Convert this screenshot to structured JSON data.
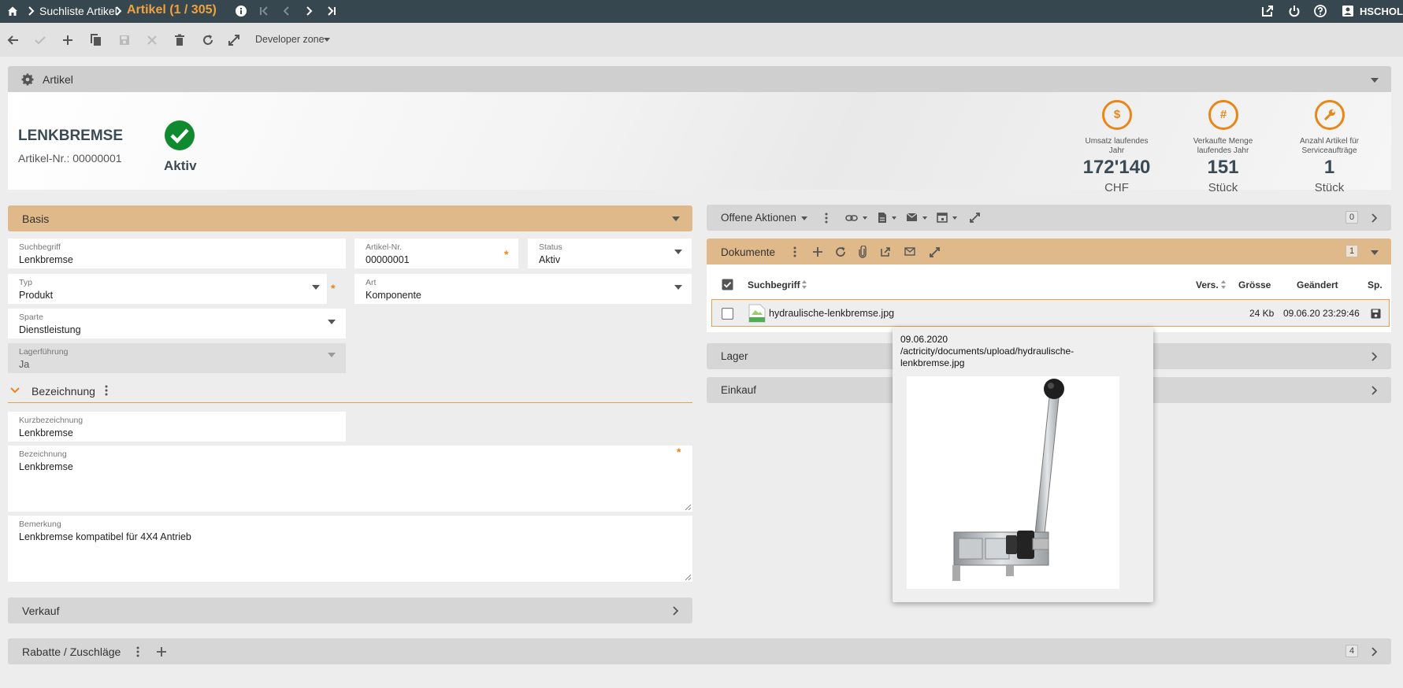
{
  "topbar": {
    "breadcrumb": "Suchliste Artikel",
    "title": "Artikel (1 / 305)",
    "user": "HSCHOL"
  },
  "toolbar": {
    "developer": "Developer zone"
  },
  "artikel_panel": {
    "title": "Artikel"
  },
  "header": {
    "name": "LENKBREMSE",
    "number": "Artikel-Nr.: 00000001",
    "status": "Aktiv"
  },
  "kpis": [
    {
      "caption1": "Umsatz laufendes",
      "caption2": "Jahr",
      "value": "172'140",
      "unit": "CHF",
      "icon": "dollar-icon"
    },
    {
      "caption1": "Verkaufte Menge",
      "caption2": "laufendes Jahr",
      "value": "151",
      "unit": "Stück",
      "icon": "hash-icon"
    },
    {
      "caption1": "Anzahl Artikel für",
      "caption2": "Serviceaufträge",
      "value": "1",
      "unit": "Stück",
      "icon": "wrench-icon"
    }
  ],
  "basis": {
    "title": "Basis",
    "suchbegriff": {
      "label": "Suchbegriff",
      "value": "Lenkbremse"
    },
    "artikelnr": {
      "label": "Artikel-Nr.",
      "value": "00000001"
    },
    "status": {
      "label": "Status",
      "value": "Aktiv"
    },
    "typ": {
      "label": "Typ",
      "value": "Produkt"
    },
    "art": {
      "label": "Art",
      "value": "Komponente"
    },
    "sparte": {
      "label": "Sparte",
      "value": "Dienstleistung"
    },
    "lager": {
      "label": "Lagerführung",
      "value": "Ja"
    },
    "req_mark": "*"
  },
  "bezeichnung": {
    "title": "Bezeichnung",
    "kurz": {
      "label": "Kurzbezeichnung",
      "value": "Lenkbremse"
    },
    "bez": {
      "label": "Bezeichnung",
      "value": "Lenkbremse"
    },
    "bemerkung": {
      "label": "Bemerkung",
      "value": "Lenkbremse kompatibel für 4X4 Antrieb"
    }
  },
  "verkauf": {
    "title": "Verkauf"
  },
  "rabatte": {
    "title": "Rabatte / Zuschläge",
    "count": "4"
  },
  "aktionen": {
    "title": "Offene Aktionen",
    "count": "0"
  },
  "dokumente": {
    "title": "Dokumente",
    "count": "1",
    "columns": {
      "suchbegriff": "Suchbegriff",
      "vers": "Vers.",
      "groesse": "Grösse",
      "geaendert": "Geändert",
      "sp": "Sp."
    },
    "row": {
      "name": "hydraulische-lenkbremse.jpg",
      "size": "24 Kb",
      "date": "09.06.20 23:29:46"
    }
  },
  "lager_panel": {
    "title": "Lager"
  },
  "einkauf_panel": {
    "title": "Einkauf"
  },
  "tooltip": {
    "line1": "09.06.2020",
    "line2": "/actricity/documents/upload/hydraulische-",
    "line3": "lenkbremse.jpg"
  },
  "colors": {
    "accent": "#e8861a",
    "topbar": "#37474f",
    "orange_panel": "#dfb989",
    "active": "#0f8a2e"
  }
}
